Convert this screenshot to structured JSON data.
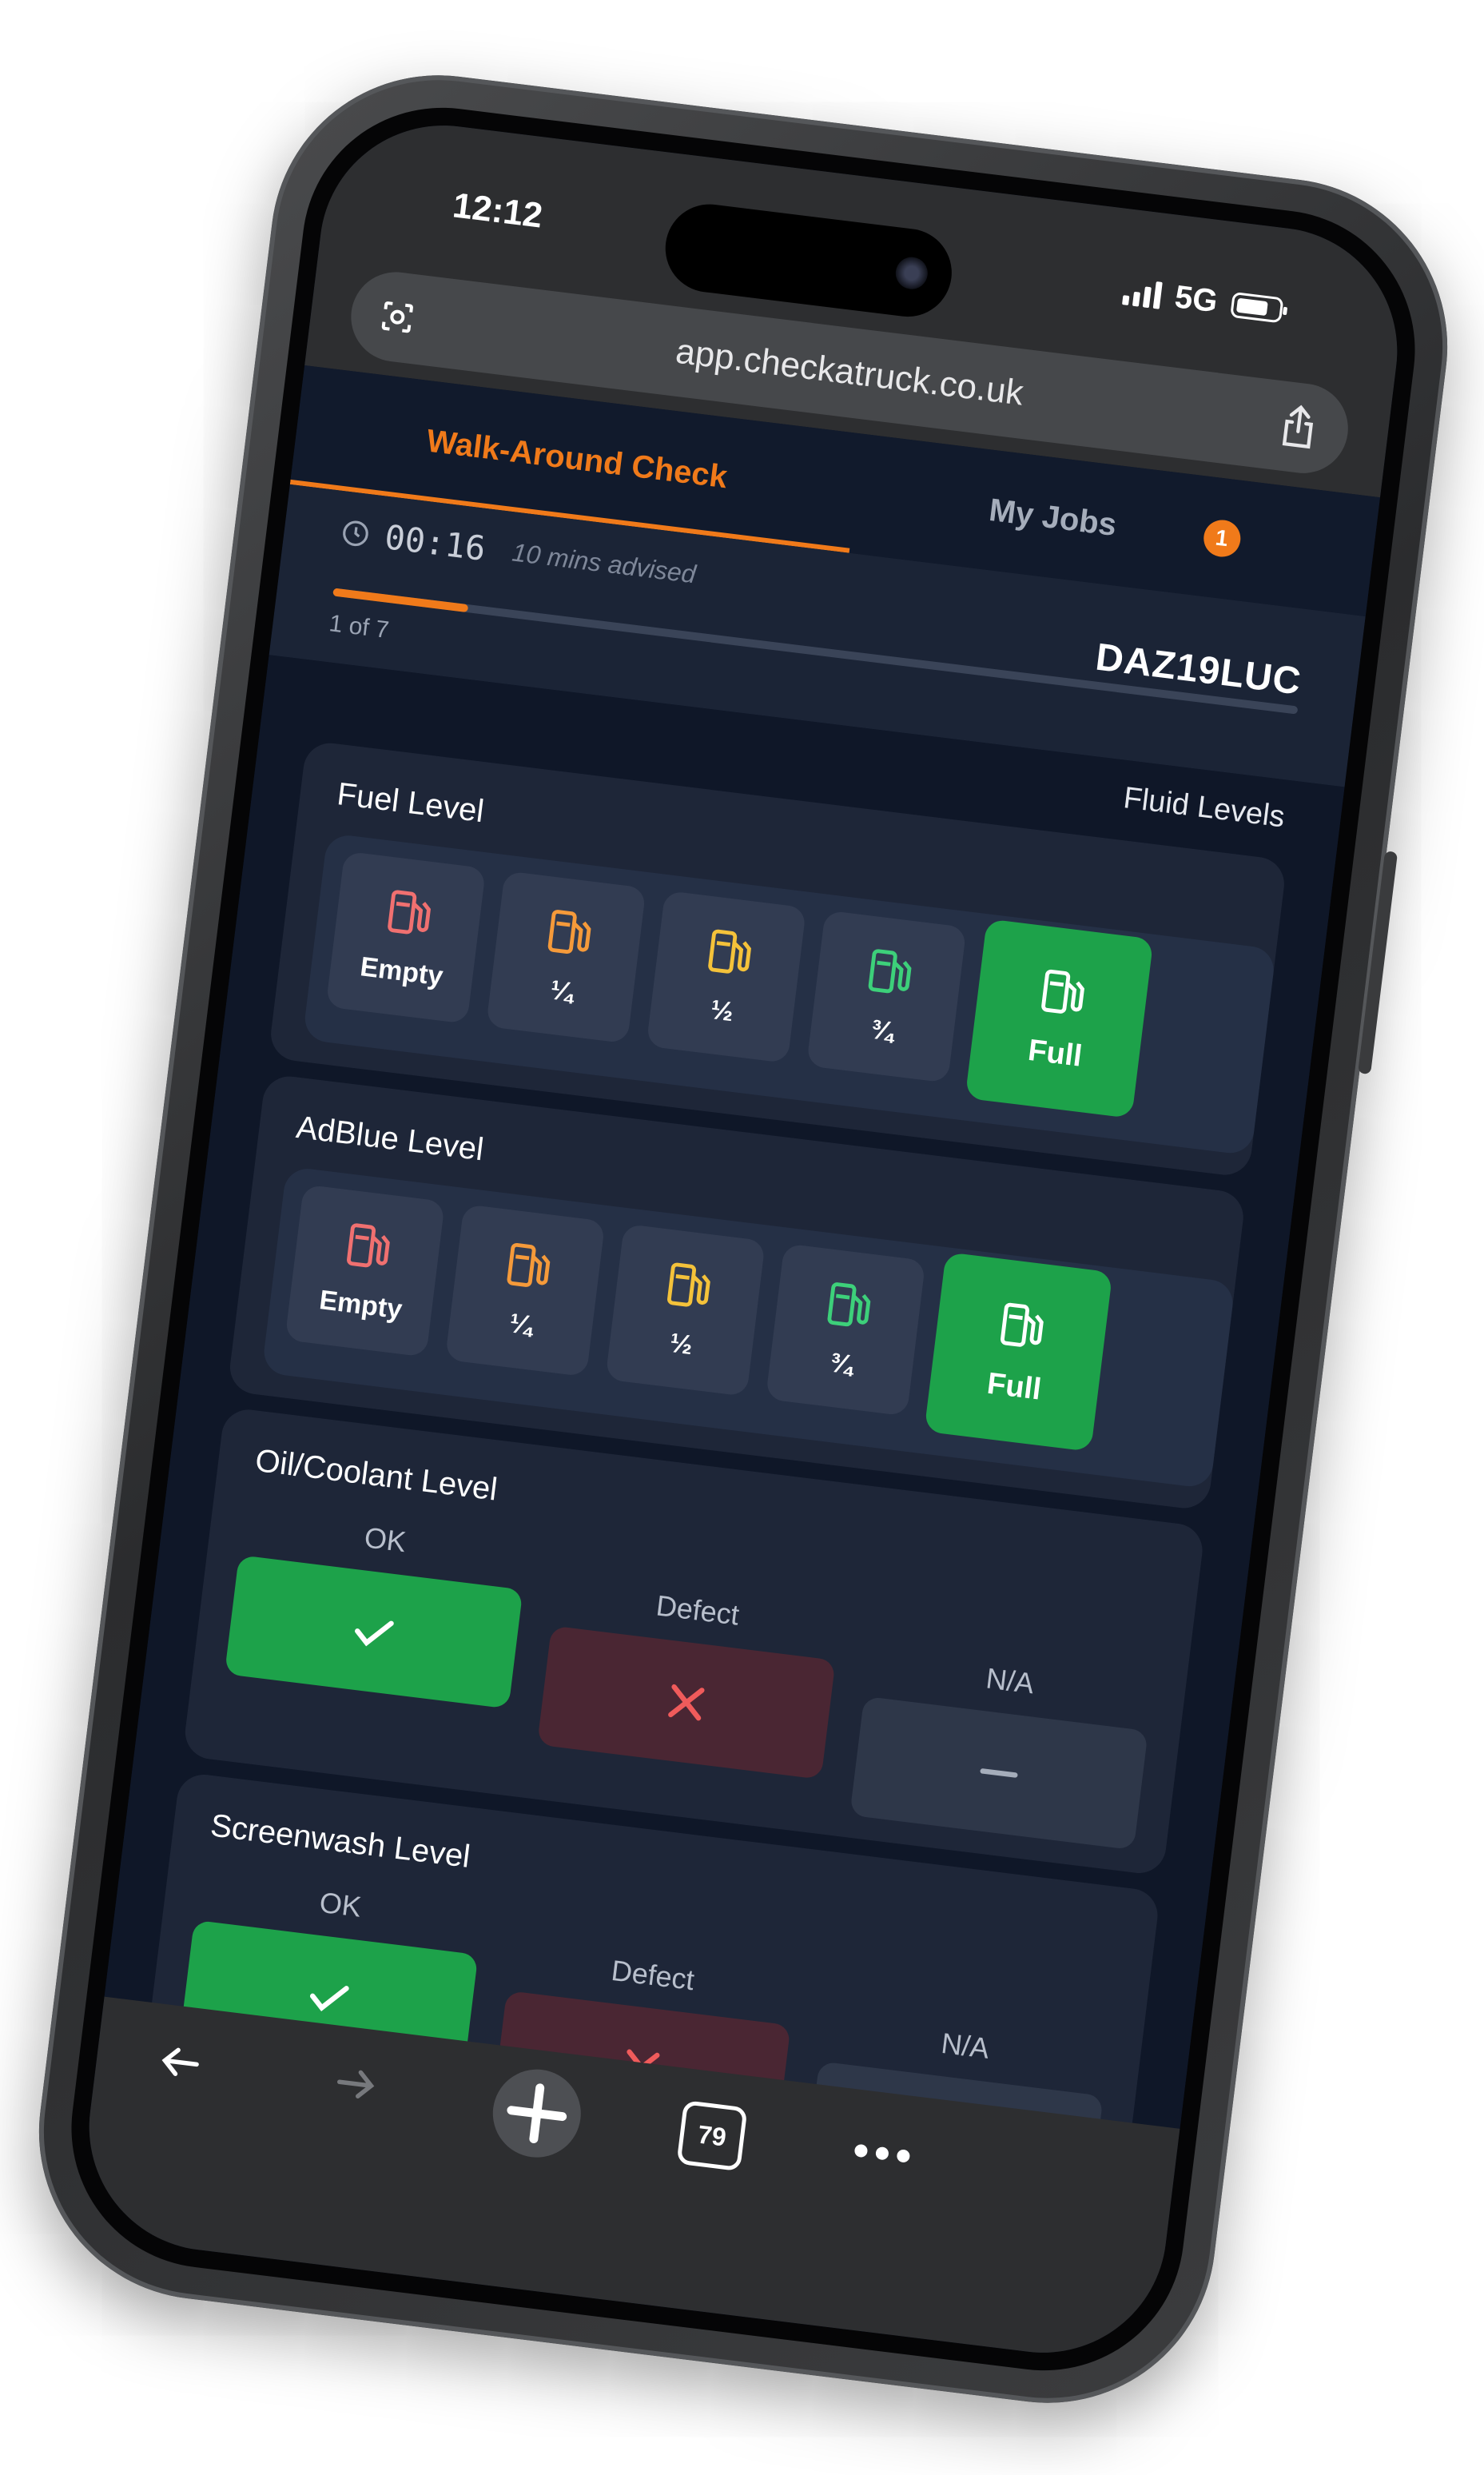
{
  "status_bar": {
    "time": "12:12",
    "network": "5G"
  },
  "browser": {
    "url": "app.checkatruck.co.uk",
    "tabs_count": "79"
  },
  "tabs": {
    "walkaround": "Walk-Around Check",
    "my_jobs": "My Jobs",
    "jobs_badge": "1"
  },
  "progress": {
    "timer": "00:16",
    "advised": "10 mins advised",
    "registration": "DAZ19LUC",
    "step_label": "1 of 7",
    "fraction": 0.14,
    "section": "Fluid Levels"
  },
  "fuel": {
    "title": "Fuel Level",
    "options": [
      "Empty",
      "¼",
      "½",
      "¾",
      "Full"
    ],
    "selected": "Full"
  },
  "adblue": {
    "title": "AdBlue Level",
    "options": [
      "Empty",
      "¼",
      "½",
      "¾",
      "Full"
    ],
    "selected": "Full"
  },
  "oil": {
    "title": "Oil/Coolant Level",
    "ok": "OK",
    "defect": "Defect",
    "na": "N/A",
    "selected": "OK"
  },
  "screenwash": {
    "title": "Screenwash Level",
    "ok": "OK",
    "defect": "Defect",
    "na": "N/A",
    "selected": "OK"
  },
  "colors": {
    "accent": "#f07a1a",
    "ok_green": "#1da24a",
    "empty": "#f07070",
    "quarter": "#f59a3a",
    "half": "#f4c23a",
    "three_quarter": "#3dd07a",
    "defect_red": "#f05b5b"
  },
  "icons": [
    "lens-icon",
    "share-icon",
    "clock-icon",
    "fuel-pump-icon",
    "check-icon",
    "cross-icon",
    "dash-icon",
    "back-arrow-icon",
    "forward-arrow-icon",
    "plus-icon",
    "tabs-icon",
    "more-icon"
  ]
}
